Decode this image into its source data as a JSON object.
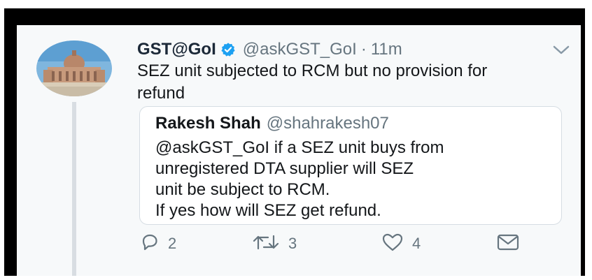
{
  "tweet": {
    "author_name": "GST@GoI",
    "handle": "@askGST_GoI",
    "separator": "·",
    "time": "11m",
    "text": "SEZ unit subjected to RCM but no provision for refund",
    "verified": true
  },
  "quoted_tweet": {
    "author_name": "Rakesh Shah",
    "handle": "@shahrakesh07",
    "lines": [
      "@askGST_GoI if a SEZ unit buys from",
      "unregistered DTA supplier will SEZ",
      "unit be subject to RCM.",
      "If yes how will SEZ get refund."
    ]
  },
  "actions": {
    "reply_count": "2",
    "retweet_count": "3",
    "like_count": "4"
  },
  "icons": {
    "verified": "verified-badge-icon",
    "menu": "chevron-down-icon",
    "reply": "reply-icon",
    "retweet": "retweet-icon",
    "like": "heart-icon",
    "dm": "envelope-icon"
  },
  "colors": {
    "frame": "#000000",
    "background": "#f7f9fa",
    "verified_blue": "#1da1f2",
    "icon_gray": "#66757f",
    "text": "#14171a"
  }
}
